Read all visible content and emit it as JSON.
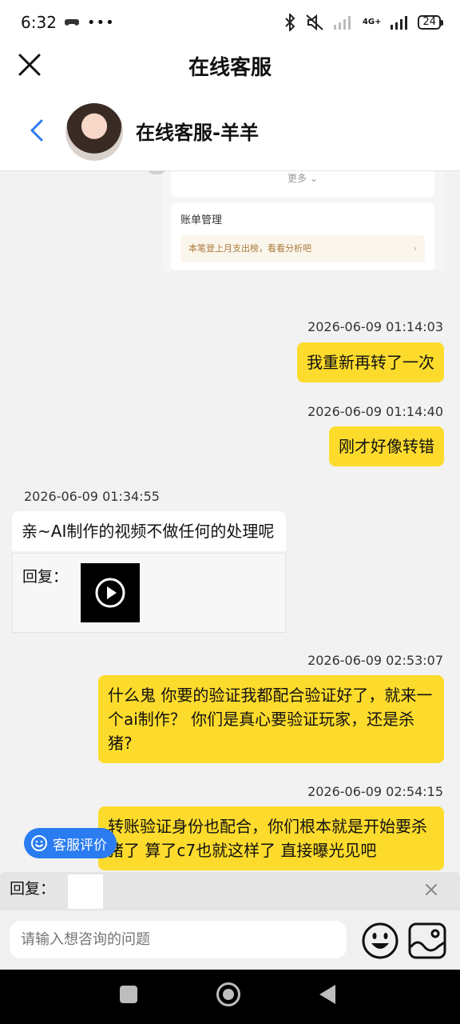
{
  "status_bar": {
    "time": "6:32",
    "battery": "24",
    "network": "4G+"
  },
  "header": {
    "title": "在线客服",
    "agent_name": "在线客服-羊羊"
  },
  "shared_screenshot": {
    "more_label": "更多",
    "bill_title": "账单管理",
    "bill_tip": "本笔登上月支出榜，看看分析吧"
  },
  "messages": [
    {
      "time": "2026-06-09 01:14:03",
      "text": "我重新再转了一次"
    },
    {
      "time": "2026-06-09 01:14:40",
      "text": "刚才好像转错"
    },
    {
      "time": "2026-06-09 01:34:55",
      "text": "亲~AI制作的视频不做任何的处理呢",
      "reply_label": "回复："
    },
    {
      "time": "2026-06-09 02:53:07",
      "text": "什么鬼 你要的验证我都配合验证好了，就来一个ai制作？ 你们是真心要验证玩家，还是杀猪?"
    },
    {
      "time": "2026-06-09 02:54:15",
      "text": "转账验证身份也配合，你们根本就是开始要杀猪了 算了c7也就这样了 直接曝光见吧"
    }
  ],
  "rate_button": "客服评价",
  "reply_bar": {
    "label": "回复："
  },
  "input": {
    "placeholder": "请输入想咨询的问题"
  },
  "colors": {
    "my_bubble": "#fddb2c",
    "rate_button": "#2a7cf0"
  }
}
